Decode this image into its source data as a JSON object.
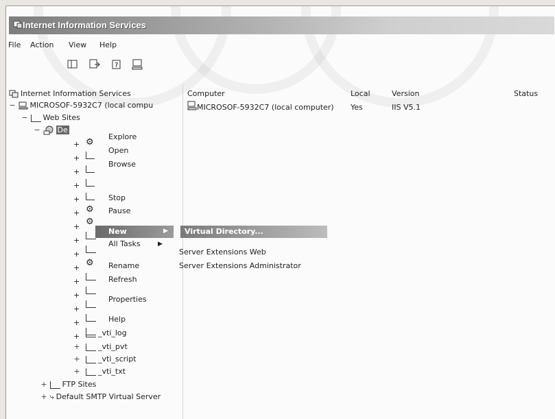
{
  "window": {
    "title": "Internet Information Services"
  },
  "menubar": {
    "items": [
      "File",
      "Action",
      "View",
      "Help"
    ]
  },
  "toolbar": {
    "icons": [
      "show-hide-console-tree-icon",
      "export-list-icon",
      "help-icon",
      "computer-icon"
    ]
  },
  "tree": {
    "root": "Internet Information Services",
    "computer": "MICROSOF-5932C7 (local compu",
    "web_sites": "Web Sites",
    "default_site": "De",
    "vti_log": "_vti_log",
    "vti_pvt": "_vti_pvt",
    "vti_script": "_vti_script",
    "vti_txt": "_vti_txt",
    "ftp_sites": "FTP Sites",
    "smtp": "Default SMTP Virtual Server"
  },
  "list": {
    "headers": [
      "Computer",
      "Local",
      "Version",
      "Status"
    ],
    "rows": [
      {
        "computer": "MICROSOF-5932C7 (local computer)",
        "local": "Yes",
        "version": "IIS V5.1",
        "status": ""
      }
    ]
  },
  "context_menu": {
    "items": [
      "Explore",
      "Open",
      "Browse",
      "Stop",
      "Pause",
      "New",
      "All Tasks",
      "Rename",
      "Refresh",
      "Properties",
      "Help"
    ],
    "selected": "New"
  },
  "submenu": {
    "items": [
      "Virtual Directory...",
      "Server Extensions Web",
      "Server Extensions Administrator"
    ],
    "selected": "Virtual Directory..."
  }
}
